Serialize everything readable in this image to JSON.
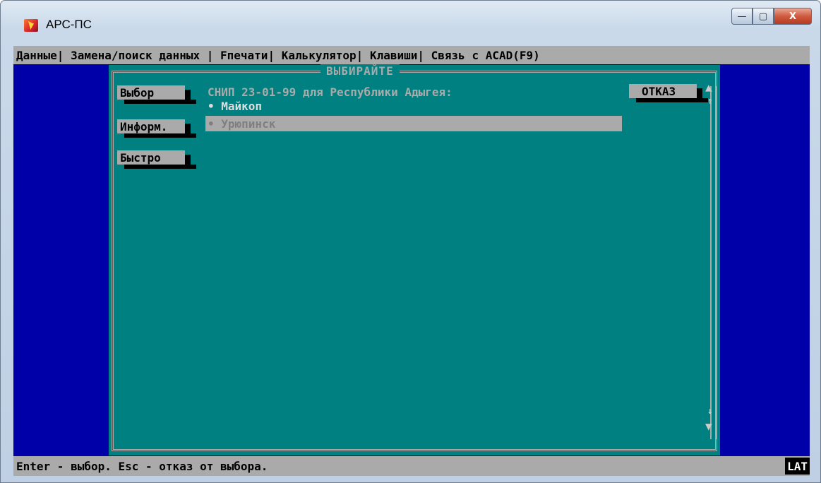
{
  "window": {
    "title": "АРС-ПС",
    "min_glyph": "—",
    "max_glyph": "▢",
    "close_glyph": "X"
  },
  "menu": [
    "Данные",
    "Замена/поиск данных",
    "Fпечати",
    "Калькулятор",
    "Клавиши",
    "Связь с ACAD(F9)"
  ],
  "dialog": {
    "title": "ВЫБИРАЙТЕ",
    "heading": "СНИП 23-01-99 для Республики Адыгея:",
    "buttons": {
      "select": "Выбор",
      "info": "Информ.",
      "quick": "Быстро",
      "cancel": "ОТКАЗ"
    },
    "items": [
      "• Майкоп",
      "• Урюпинск"
    ],
    "selected_index": 1
  },
  "status": {
    "text": "Enter - выбор. Esc - отказ от выбора.",
    "indicator": "LAT"
  },
  "icons": {
    "up_arrow": "▲",
    "down_arrow": "▼",
    "scroll_up": "↑",
    "scroll_down": "↓"
  }
}
